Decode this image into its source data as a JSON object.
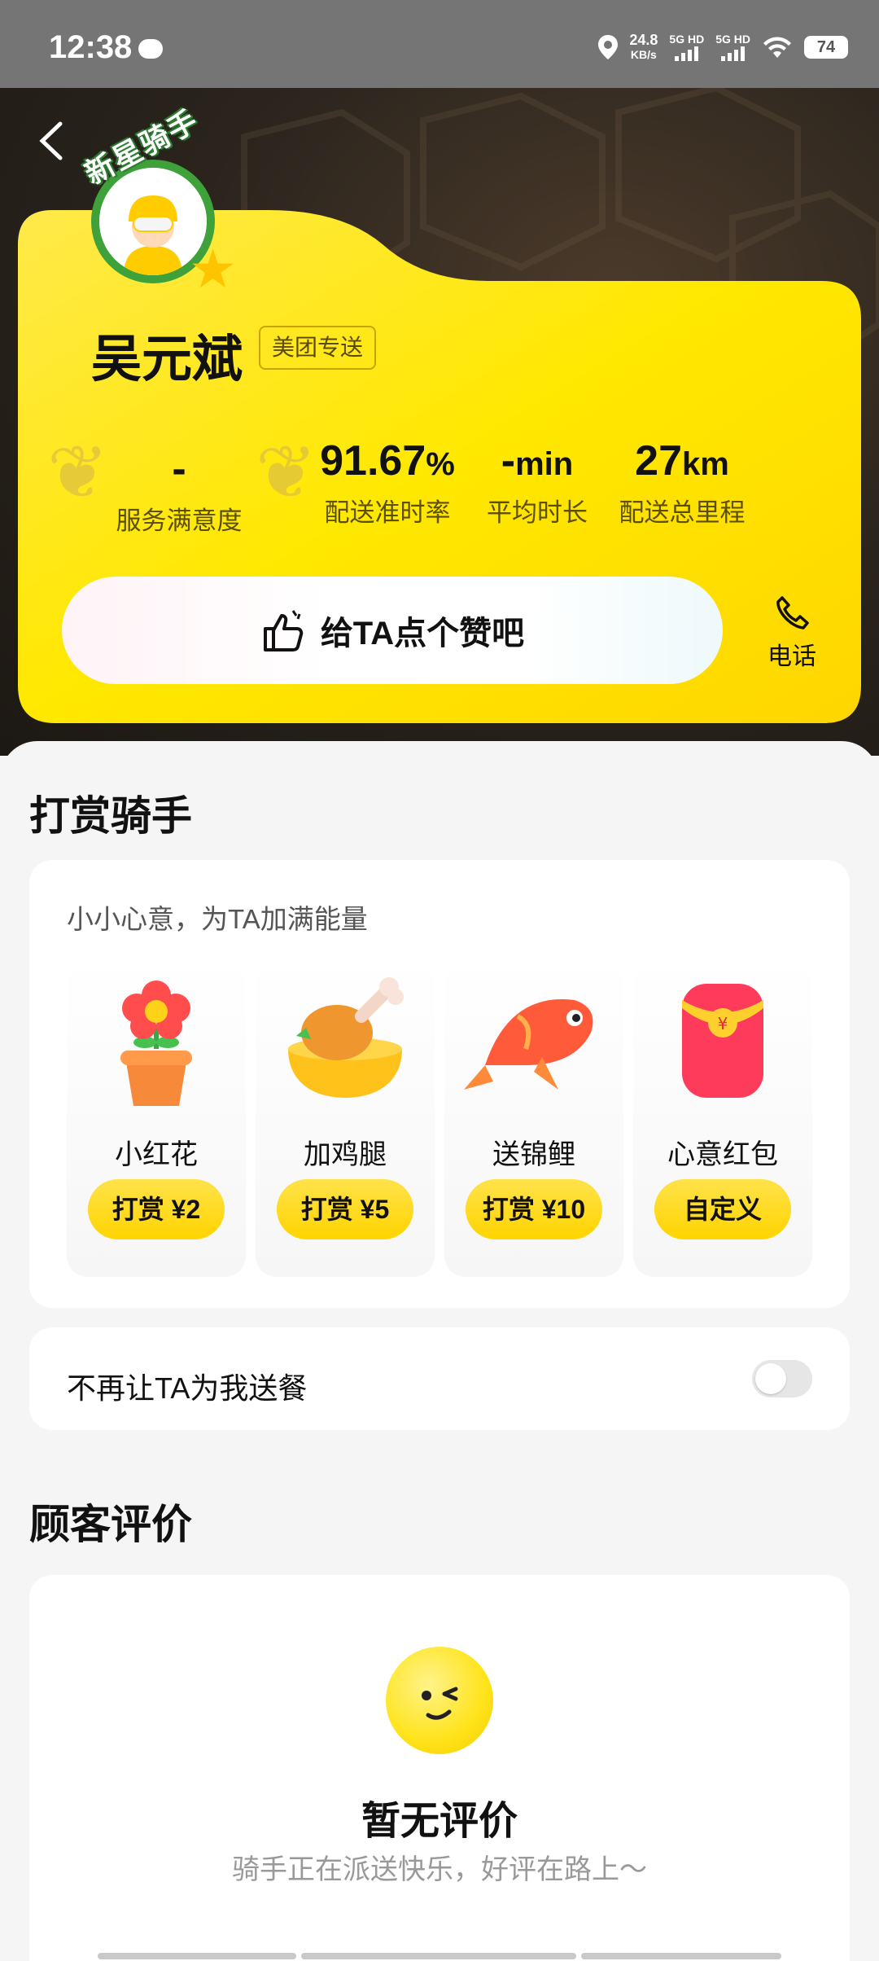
{
  "status_bar": {
    "time": "12:38",
    "speed_value": "24.8",
    "speed_unit": "KB/s",
    "sig1": "5G HD",
    "sig2": "5G HD",
    "battery": "74"
  },
  "rider": {
    "badge": "新星骑手",
    "name": "吴元斌",
    "tag": "美团专送"
  },
  "stats": [
    {
      "value": "-",
      "unit": "",
      "label": "服务满意度"
    },
    {
      "value": "91.67",
      "unit": "%",
      "label": "配送准时率"
    },
    {
      "value": "-",
      "unit": "min",
      "label": "平均时长"
    },
    {
      "value": "27",
      "unit": "km",
      "label": "配送总里程"
    }
  ],
  "like_button": "给TA点个赞吧",
  "phone_label": "电话",
  "tip_section": {
    "title": "打赏骑手",
    "subtitle": "小小心意，为TA加满能量",
    "gifts": [
      {
        "name": "小红花",
        "button": "打赏 ¥2"
      },
      {
        "name": "加鸡腿",
        "button": "打赏 ¥5"
      },
      {
        "name": "送锦鲤",
        "button": "打赏 ¥10"
      },
      {
        "name": "心意红包",
        "button": "自定义"
      }
    ]
  },
  "block_rider": {
    "label": "不再让TA为我送餐",
    "enabled": false
  },
  "reviews": {
    "title": "顾客评价",
    "empty_title": "暂无评价",
    "empty_subtitle": "骑手正在派送快乐，好评在路上～"
  },
  "colors": {
    "brand_yellow": "#ffdd00",
    "dark_bg": "#2a241d",
    "badge_green": "#3fa13a"
  }
}
